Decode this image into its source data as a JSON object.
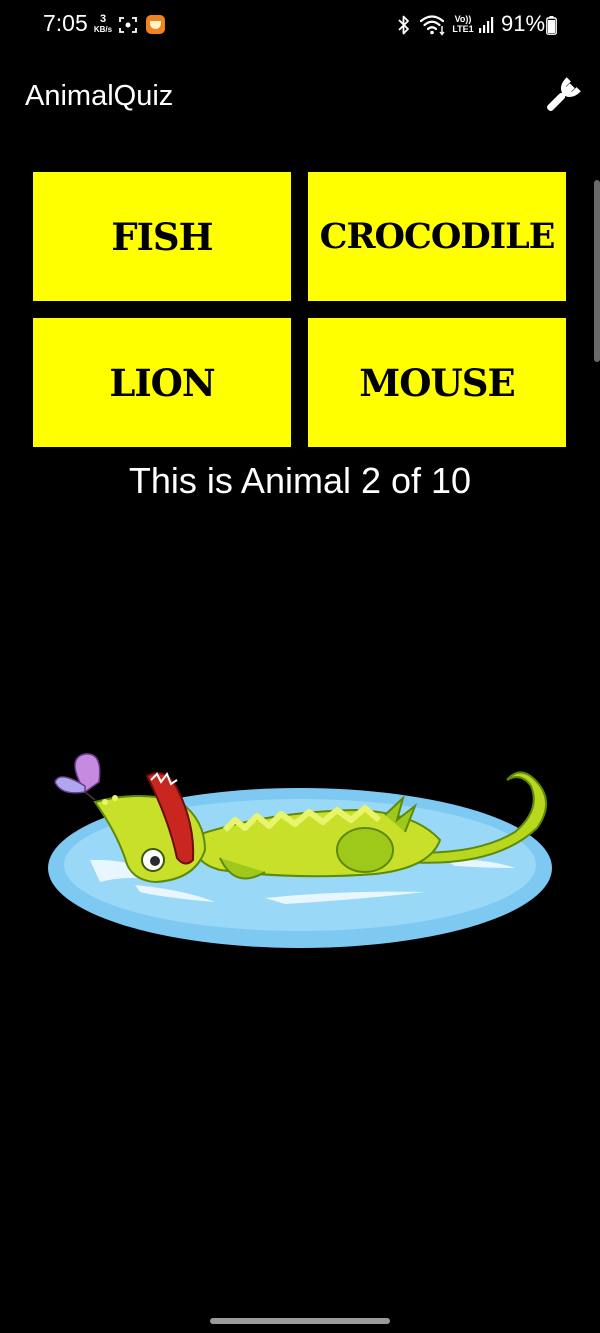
{
  "status_bar": {
    "time": "7:05",
    "net_speed_value": "3",
    "net_speed_unit": "KB/s",
    "network_label_top": "Vo))",
    "network_label_bottom": "LTE1",
    "battery_percent": "91%",
    "icons": [
      "screen-record-icon",
      "app-notification-icon",
      "bluetooth-icon",
      "wifi-icon",
      "signal-icon",
      "battery-icon"
    ]
  },
  "app_bar": {
    "title": "AnimalQuiz",
    "settings_icon": "wrench-icon"
  },
  "quiz": {
    "answers": [
      "FISH",
      "CROCODILE",
      "LION",
      "MOUSE"
    ],
    "progress_text": "This is Animal 2 of 10",
    "image": "crocodile-in-pond-illustration"
  },
  "colors": {
    "background": "#000000",
    "answer_button": "#ffff00",
    "text": "#ffffff"
  }
}
